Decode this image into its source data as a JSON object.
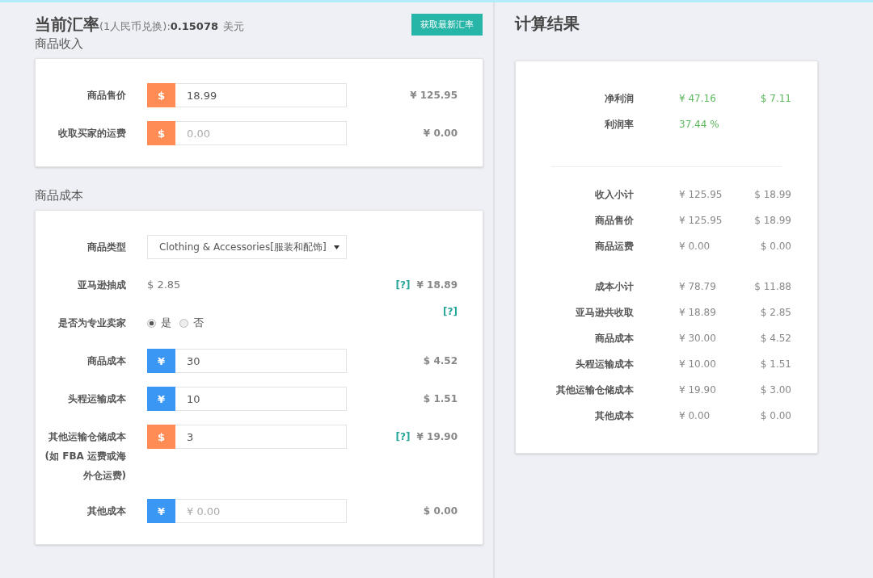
{
  "header": {
    "title": "当前汇率",
    "note": "(1人民币兑换):",
    "rate": "0.15078",
    "unit": "美元",
    "button": "获取最新汇率"
  },
  "income": {
    "title": "商品收入",
    "rows": [
      {
        "kind": "input",
        "label": "商品售价",
        "prefix": {
          "text": "$",
          "color": "#ff8c55"
        },
        "value": "18.99",
        "result": "¥ 125.95"
      },
      {
        "kind": "input",
        "label": "收取买家的运费",
        "prefix": {
          "text": "$",
          "color": "#ff8c55"
        },
        "placeholder": "0.00",
        "result": "¥ 0.00"
      }
    ]
  },
  "cost": {
    "title": "商品成本",
    "rows": [
      {
        "kind": "select",
        "label": "商品类型",
        "value": "Clothing & Accessories[服装和配饰]"
      },
      {
        "kind": "text",
        "label": "亚马逊抽成",
        "value": "$ 2.85",
        "help": "[?]",
        "result": "¥ 18.89"
      },
      {
        "kind": "radio",
        "label": "是否为专业卖家",
        "options": [
          {
            "label": "是",
            "selected": true
          },
          {
            "label": "否",
            "selected": false
          }
        ],
        "help": "[?]"
      },
      {
        "kind": "input",
        "label": "商品成本",
        "prefix": {
          "text": "¥",
          "color": "#3a97f3"
        },
        "value": "30",
        "result": "$ 4.52"
      },
      {
        "kind": "input",
        "label": "头程运输成本",
        "prefix": {
          "text": "¥",
          "color": "#3a97f3"
        },
        "value": "10",
        "result": "$ 1.51"
      },
      {
        "kind": "input",
        "label": "其他运输仓储成本(如 FBA 运费或海外仓运费)",
        "prefix": {
          "text": "$",
          "color": "#ff8c55"
        },
        "value": "3",
        "help": "[?]",
        "result": "¥ 19.90"
      },
      {
        "kind": "input",
        "label": "其他成本",
        "prefix": {
          "text": "¥",
          "color": "#3a97f3"
        },
        "placeholder": "¥ 0.00",
        "result": "$ 0.00"
      }
    ]
  },
  "results": {
    "title": "计算结果",
    "summary": [
      {
        "label": "净利润",
        "cny": "¥ 47.16",
        "usd": "$ 7.11",
        "highlight": true
      },
      {
        "label": "利润率",
        "cny": "37.44 %",
        "highlight": true
      }
    ],
    "groups": [
      [
        {
          "label": "收入小计",
          "cny": "¥ 125.95",
          "usd": "$ 18.99",
          "highlight": false
        },
        {
          "label": "商品售价",
          "cny": "¥ 125.95",
          "usd": "$ 18.99",
          "highlight": false
        },
        {
          "label": "商品运费",
          "cny": "¥ 0.00",
          "usd": "$ 0.00",
          "highlight": false
        }
      ],
      [
        {
          "label": "成本小计",
          "cny": "¥ 78.79",
          "usd": "$ 11.88",
          "highlight": false
        },
        {
          "label": "亚马逊共收取",
          "cny": "¥ 18.89",
          "usd": "$ 2.85",
          "highlight": false
        },
        {
          "label": "商品成本",
          "cny": "¥ 30.00",
          "usd": "$ 4.52",
          "highlight": false
        },
        {
          "label": "头程运输成本",
          "cny": "¥ 10.00",
          "usd": "$ 1.51",
          "highlight": false
        },
        {
          "label": "其他运输仓储成本",
          "cny": "¥ 19.90",
          "usd": "$ 3.00",
          "highlight": false
        },
        {
          "label": "其他成本",
          "cny": "¥ 0.00",
          "usd": "$ 0.00",
          "highlight": false
        }
      ]
    ]
  }
}
